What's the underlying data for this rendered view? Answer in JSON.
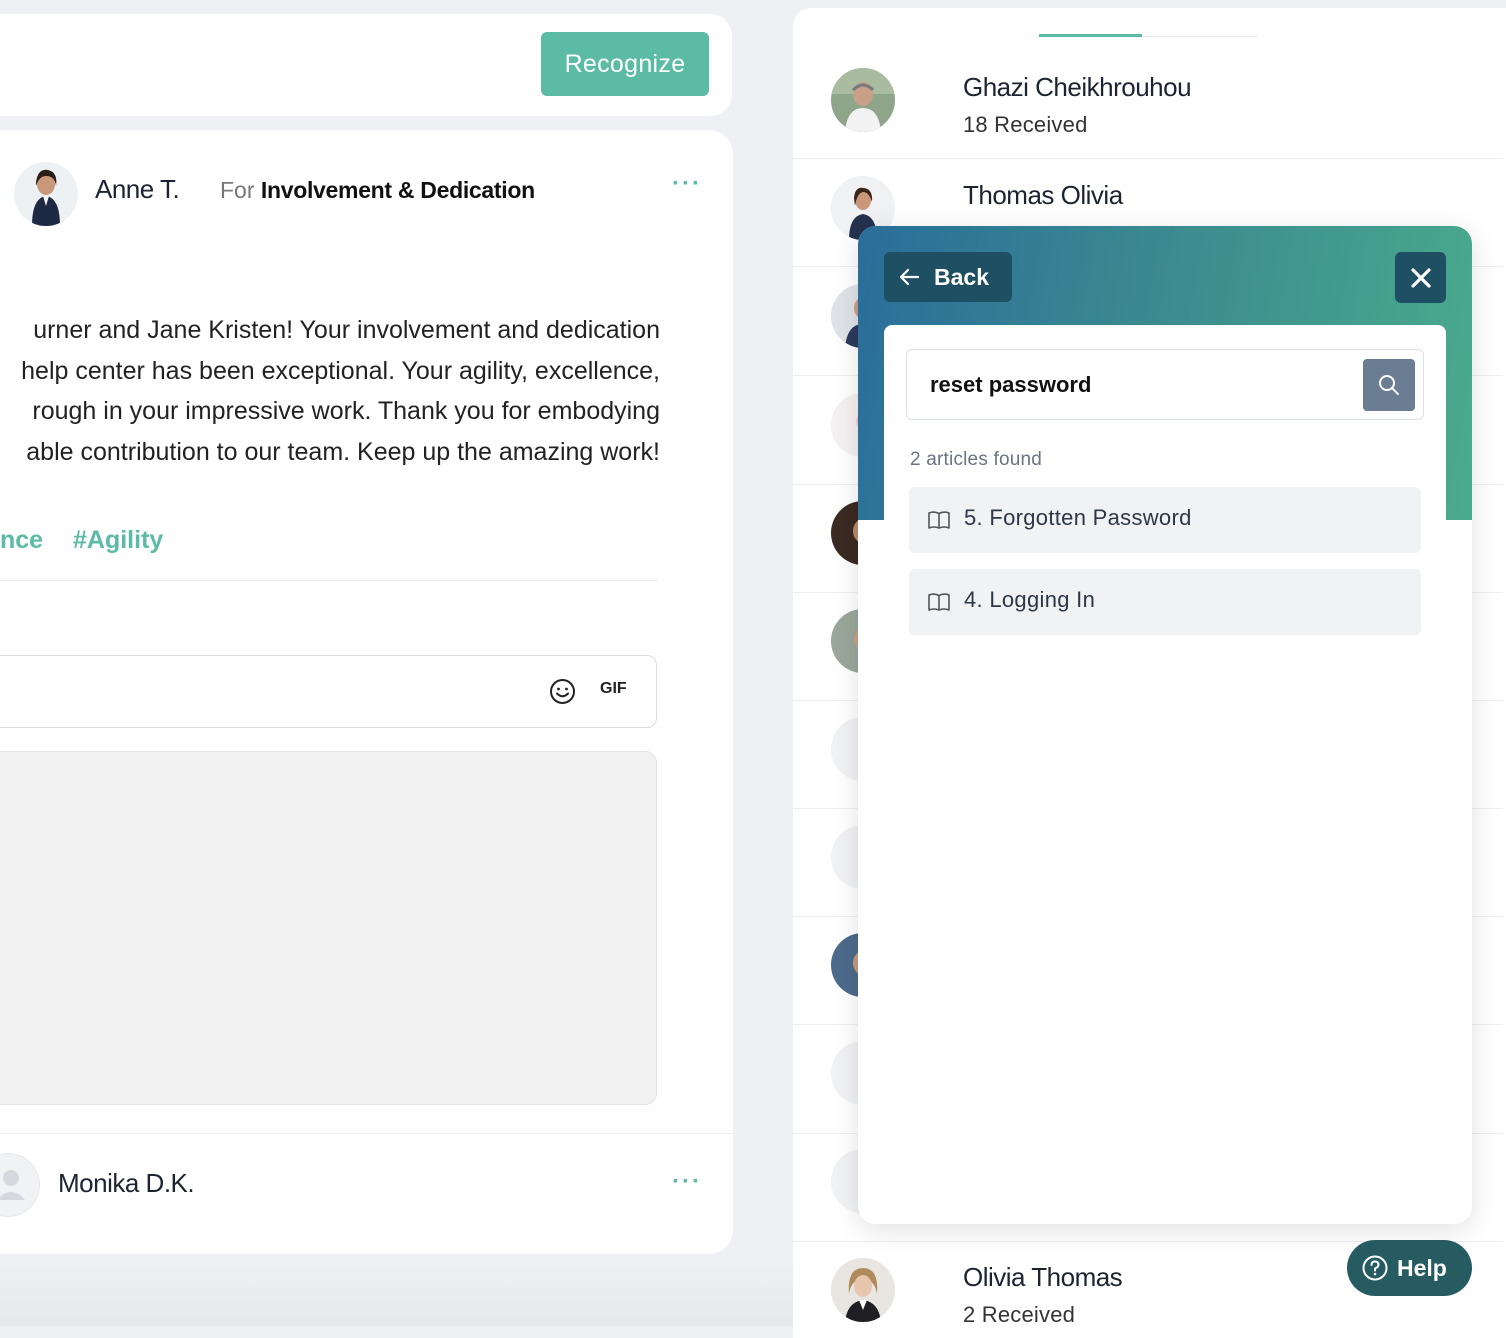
{
  "feed": {
    "recognize_label": "Recognize",
    "post": {
      "author": "Anne T.",
      "for_prefix": "For",
      "category": "Involvement & Dedication",
      "more": "···",
      "lines": [
        "urner and Jane Kristen! Your involvement and dedication",
        "help center has been exceptional. Your agility, excellence,",
        "rough in your impressive work. Thank you for embodying",
        "able contribution to our team. Keep up the amazing work!"
      ],
      "tags": [
        "nce",
        "#Agility"
      ],
      "comment": {
        "gif_label": "GIF"
      }
    },
    "next_post": {
      "author": "Monika D.K.",
      "more": "···"
    }
  },
  "leaderboard": {
    "rows": [
      {
        "name": "Ghazi Cheikhrouhou",
        "count": "18 Received"
      },
      {
        "name": "Thomas Olivia",
        "count": ""
      },
      {
        "name": "Olivia Thomas",
        "count": "2 Received"
      }
    ]
  },
  "help_widget": {
    "back_label": "Back",
    "search": {
      "value": "reset password"
    },
    "results_text": "2 articles found",
    "articles": [
      {
        "title": "5. Forgotten Password",
        "icon": "book-icon"
      },
      {
        "title": "4. Logging In",
        "icon": "book-icon"
      }
    ],
    "help_button_label": "Help",
    "colors": {
      "header_start": "#2a6d9a",
      "header_end": "#4aab8c",
      "button_dark": "#1f4f63",
      "accent": "#5bbba5"
    }
  }
}
